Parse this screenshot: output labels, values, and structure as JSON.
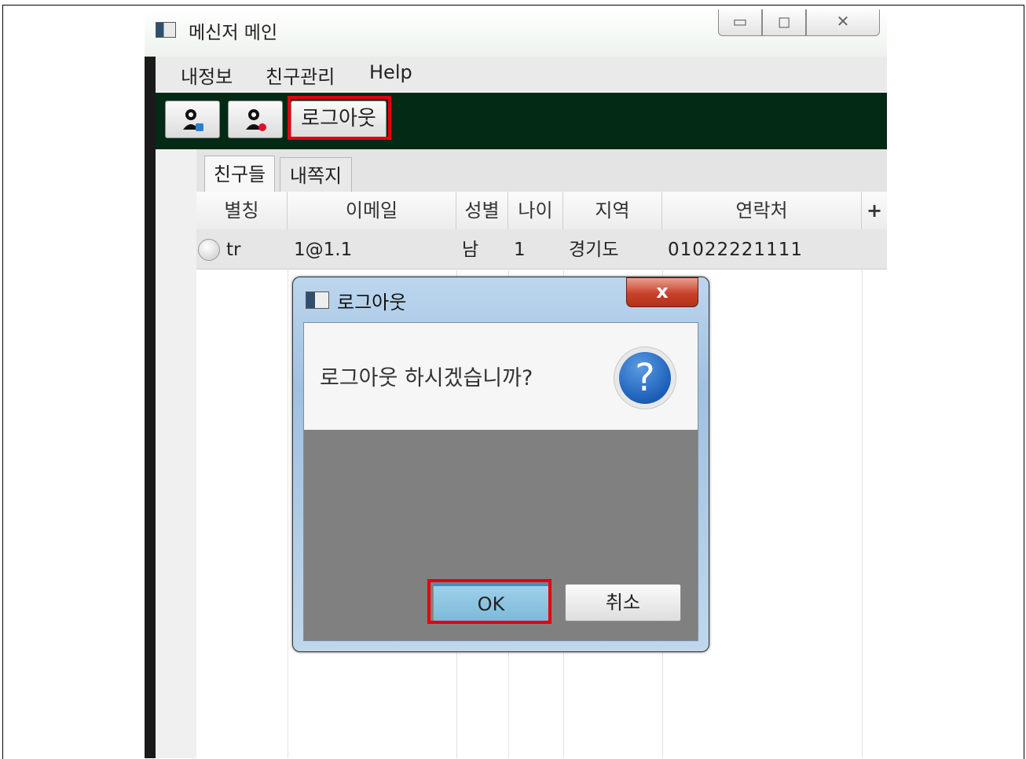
{
  "window": {
    "title": "메신저 메인"
  },
  "menu": {
    "items": [
      "내정보",
      "친구관리",
      "Help"
    ]
  },
  "toolbar": {
    "logout_label": "로그아웃"
  },
  "tabs": [
    {
      "label": "친구들"
    },
    {
      "label": "내쪽지"
    }
  ],
  "table": {
    "headers": [
      "별칭",
      "이메일",
      "성별",
      "나이",
      "지역",
      "연락처"
    ],
    "add_column": "+",
    "rows": [
      {
        "nickname": "tr",
        "email": "1@1.1",
        "gender": "남",
        "age": "1",
        "region": "경기도",
        "phone": "01022221111"
      }
    ]
  },
  "dialog": {
    "title": "로그아웃",
    "close_glyph": "x",
    "message": "로그아웃 하시겠습니까?",
    "icon_glyph": "?",
    "ok_label": "OK",
    "cancel_label": "취소"
  },
  "colors": {
    "toolbar_bg": "#022a14",
    "highlight_box": "#e3000f",
    "dialog_body": "#808080"
  }
}
